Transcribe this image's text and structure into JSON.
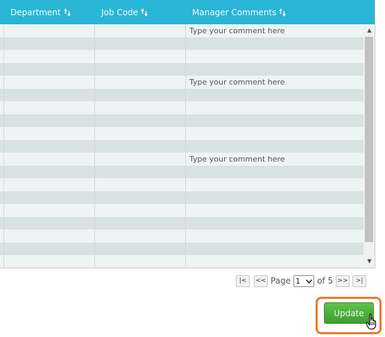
{
  "table": {
    "columns": [
      {
        "label": "Department"
      },
      {
        "label": "Job Code"
      },
      {
        "label": "Manager Comments"
      }
    ],
    "comment_placeholder": "Type your comment here",
    "rows": 19
  },
  "pagination": {
    "first": "|<",
    "prev": "<<",
    "page_label": "Page",
    "current_page": "1",
    "of_label": "of 5",
    "next": ">>",
    "last": ">|"
  },
  "actions": {
    "update_label": "Update"
  },
  "colors": {
    "header": "#29b5d5",
    "row_light": "#eef3f3",
    "row_dark": "#d8e2e1",
    "update_button": "#4db23a",
    "highlight_frame": "#f0782a"
  }
}
